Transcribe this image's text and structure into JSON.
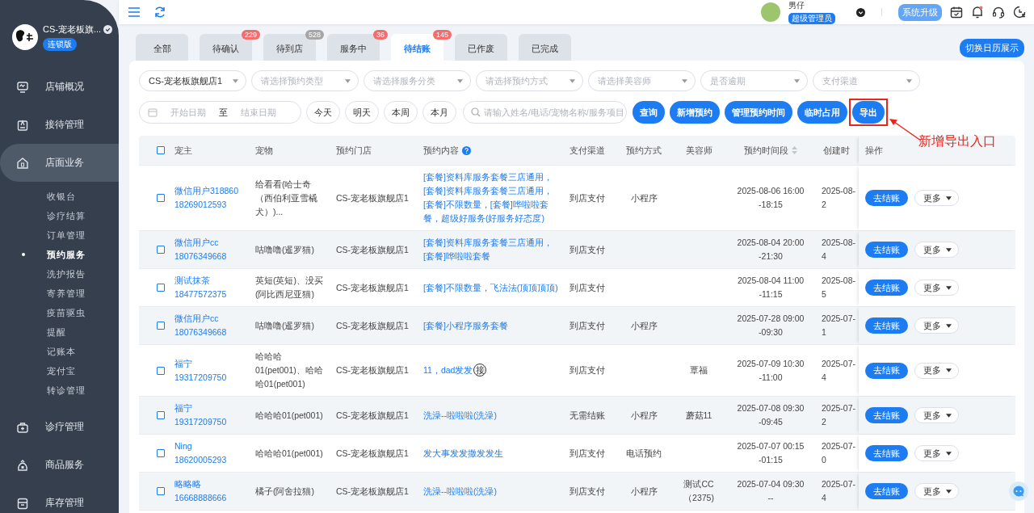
{
  "sidebar": {
    "store_name": "CS-宠老板旗...",
    "edition": "连锁版",
    "items": [
      {
        "label": "店铺概况",
        "selected": false
      },
      {
        "label": "接待管理",
        "selected": false
      },
      {
        "label": "店面业务",
        "selected": true,
        "children": [
          {
            "label": "收银台",
            "selected": false
          },
          {
            "label": "诊疗结算",
            "selected": false
          },
          {
            "label": "订单管理",
            "selected": false
          },
          {
            "label": "预约服务",
            "selected": true
          },
          {
            "label": "洗护报告",
            "selected": false
          },
          {
            "label": "寄养管理",
            "selected": false
          },
          {
            "label": "疫苗驱虫",
            "selected": false
          },
          {
            "label": "提醒",
            "selected": false
          },
          {
            "label": "记账本",
            "selected": false
          },
          {
            "label": "宠付宝",
            "selected": false
          },
          {
            "label": "转诊管理",
            "selected": false
          }
        ]
      },
      {
        "label": "诊疗管理",
        "selected": false
      },
      {
        "label": "商品服务",
        "selected": false
      },
      {
        "label": "库存管理",
        "selected": false
      }
    ]
  },
  "header": {
    "user_name": "男仔",
    "user_role": "超级管理员",
    "upgrade_button": "系统升级",
    "notification_dot": true
  },
  "tabs": [
    {
      "label": "全部",
      "selected": false
    },
    {
      "label": "待确认",
      "selected": false,
      "badge": "229",
      "color": "#f56c6c"
    },
    {
      "label": "待到店",
      "selected": false,
      "badge": "528",
      "color": "#a6a6a6"
    },
    {
      "label": "服务中",
      "selected": false,
      "badge": "36",
      "color": "#f56c6c"
    },
    {
      "label": "待结账",
      "selected": true,
      "badge": "145",
      "color": "#f56c6c"
    },
    {
      "label": "已作废",
      "selected": false
    },
    {
      "label": "已完成",
      "selected": false
    }
  ],
  "calendar_button": "切换日历展示",
  "filters": {
    "selects": [
      {
        "value": "CS-宠老板旗舰店1"
      },
      {
        "placeholder": "请选择预约类型"
      },
      {
        "placeholder": "请选择服务分类"
      },
      {
        "placeholder": "请选择预约方式"
      },
      {
        "placeholder": "请选择美容师"
      },
      {
        "placeholder": "是否逾期"
      },
      {
        "placeholder": "支付渠道"
      }
    ],
    "date_range": {
      "start_placeholder": "开始日期",
      "separator": "至",
      "end_placeholder": "结束日期"
    },
    "quick_dates": [
      "今天",
      "明天",
      "本周",
      "本月"
    ],
    "search": {
      "placeholder": "请输入姓名/电话/宠物名称/服务项目"
    },
    "buttons": [
      "查询",
      "新增预约",
      "管理预约时间",
      "临时占用",
      "导出"
    ]
  },
  "table": {
    "select_all_checked": false,
    "columns": [
      {
        "label": "宠主",
        "kind": "plain"
      },
      {
        "label": "宠物",
        "kind": "plain"
      },
      {
        "label": "预约门店",
        "kind": "plain"
      },
      {
        "label": "预约内容",
        "kind": "help"
      },
      {
        "label": "支付渠道",
        "kind": "plain"
      },
      {
        "label": "预约方式",
        "kind": "plain"
      },
      {
        "label": "美容师",
        "kind": "plain"
      },
      {
        "label": "预约时间段",
        "kind": "sort"
      },
      {
        "label": "创建时",
        "kind": "plain"
      },
      {
        "label": "操作",
        "kind": "plain"
      }
    ],
    "rows": [
      {
        "checked": false,
        "owner": "微信用户318860",
        "phone": "18269012593",
        "pet": "给看看(哈士奇（西伯利亚雪橇犬）)...",
        "store": "CS-宠老板旗舰店1",
        "content": "[套餐]资料库服务套餐三店通用，[套餐]资料库服务套餐三店通用，[套餐]不限数量，[套餐]哗啦啦套餐，超级好服务(好服务好态度)",
        "payment": "到店支付",
        "method": "小程序",
        "time": [
          "2025-08-06 16:00",
          "-18:15"
        ],
        "created": [
          "2025-08-",
          "2"
        ],
        "actions": [
          "去结账",
          "更多"
        ]
      },
      {
        "checked": false,
        "owner": "微信用户cc",
        "phone": "18076349668",
        "pet": "咕噜噜(暹罗猫)",
        "store": "CS-宠老板旗舰店1",
        "content": "[套餐]资料库服务套餐三店通用，[套餐]哗啦啦套餐",
        "payment": "到店支付",
        "time": [
          "2025-08-04 20:00",
          "-21:30"
        ],
        "created": [
          "2025-08-",
          "4"
        ],
        "actions": [
          "去结账",
          "更多"
        ]
      },
      {
        "checked": false,
        "owner": "测试抹茶",
        "phone": "18477572375",
        "pet": "英短(英短)、没买(阿比西尼亚猫)",
        "store": "CS-宠老板旗舰店1",
        "content": "[套餐]不限数量，飞法法(顶顶顶顶)",
        "payment": "到店支付",
        "time": [
          "2025-08-04 11:00",
          "-11:15"
        ],
        "created": [
          "2025-08-",
          "5"
        ],
        "actions": [
          "去结账",
          "更多"
        ]
      },
      {
        "checked": false,
        "owner": "微信用户cc",
        "phone": "18076349668",
        "pet": "咕噜噜(暹罗猫)",
        "store": "CS-宠老板旗舰店1",
        "content": "[套餐]小程序服务套餐",
        "payment": "到店支付",
        "method": "小程序",
        "time": [
          "2025-07-28 09:00",
          "-09:30"
        ],
        "created": [
          "2025-07-",
          "1"
        ],
        "actions": [
          "去结账",
          "更多"
        ]
      },
      {
        "checked": false,
        "owner": "福宁",
        "phone": "19317209750",
        "pet": "哈哈哈01(pet001)、哈哈哈01(pet001)",
        "store": "CS-宠老板旗舰店1",
        "content": "11，dad发发",
        "content_tag": "接",
        "payment": "到店支付",
        "groomer": "覃福",
        "time": [
          "2025-07-09 10:30",
          "-11:00"
        ],
        "created": [
          "2025-07-",
          "4"
        ],
        "actions": [
          "去结账",
          "更多"
        ]
      },
      {
        "checked": false,
        "owner": "福宁",
        "phone": "19317209750",
        "pet": "哈哈哈01(pet001)",
        "store": "CS-宠老板旗舰店1",
        "content": "洗澡--啦啦啦(洗澡)",
        "payment": "无需结账",
        "method": "小程序",
        "groomer": "蘑菇11",
        "time": [
          "2025-07-08 09:30",
          "-09:45"
        ],
        "created": [
          "2025-07-",
          "2"
        ],
        "actions": [
          "去结账",
          "更多"
        ]
      },
      {
        "checked": false,
        "owner": "Ning",
        "phone": "18620005293",
        "pet": "哈哈哈01(pet001)",
        "store": "CS-宠老板旗舰店1",
        "content": "发大事发发撒发发生",
        "payment": "到店支付",
        "method": "电话预约",
        "time": [
          "2025-07-07 00:15",
          "-01:15"
        ],
        "created": [
          "2025-07-",
          "0"
        ],
        "actions": [
          "去结账",
          "更多"
        ]
      },
      {
        "checked": false,
        "owner": "略略略",
        "phone": "16668888666",
        "pet": "橘子(阿舍拉猫)",
        "store": "CS-宠老板旗舰店1",
        "content": "洗澡--啦啦啦(洗澡)",
        "payment": "到店支付",
        "method": "小程序",
        "groomer": "测试CC（2375)",
        "time": [
          "2025-07-04 09:30",
          "--"
        ],
        "created": [
          "2025-07-",
          "4"
        ],
        "actions": [
          "去结账",
          "更多"
        ]
      }
    ]
  },
  "annotation": {
    "text": "新增导出入口"
  }
}
